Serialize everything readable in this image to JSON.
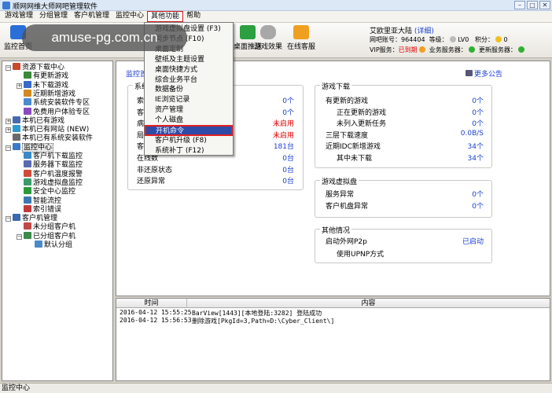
{
  "window": {
    "title": "顺网网维大师网吧管理软件",
    "min": "–",
    "max": "□",
    "close": "✕"
  },
  "menubar": [
    "游戏管理",
    "分组管理",
    "客户机管理",
    "监控中心",
    "其他功能",
    "帮助"
  ],
  "toolbar": {
    "buttons": [
      {
        "label": "监控首页",
        "icon": "monitor-home-icon",
        "color": "#2a6fd8"
      },
      {
        "label": "桌面推送",
        "icon": "desktop-push-icon",
        "color": "#2aa040"
      },
      {
        "label": "游戏效果",
        "icon": "gamepad-icon",
        "color": "#9a9a9a"
      },
      {
        "label": "在线客服",
        "icon": "customer-service-icon",
        "color": "#f0a020"
      }
    ],
    "account": {
      "name": "艾欧里亚大陆",
      "detail_link": "(详细)",
      "netbar_label": "网吧账号：",
      "netbar_id": "964404",
      "level_label": "等级：",
      "level": "LV0",
      "points_label": "积分：",
      "points": "0",
      "vip_label": "VIP服务：",
      "vip_status": "已到期",
      "biz_server_label": "业务服务器：",
      "update_server_label": "更新服务器："
    }
  },
  "watermark": "amuse-pg.com.cn",
  "dropdown": {
    "items": [
      "游戏虚拟盘设置 (F3)",
      "同步节点 (F10)",
      "桌面定制",
      "壁纸及主题设置",
      "桌面快捷方式",
      "综合业务平台",
      "数据备份",
      "IE浏览记录",
      "资产管理",
      "个人磁盘",
      "开机命令",
      "客户机升级 (F8)",
      "系统补丁 (F12)"
    ],
    "highlighted_index": 10
  },
  "tree": [
    {
      "label": "资源下载中心",
      "level": 0,
      "expander": "⊟",
      "color": "#c84a2a"
    },
    {
      "label": "有更新游戏",
      "level": 1,
      "color": "#3a8a3a"
    },
    {
      "label": "未下载游戏",
      "level": 1,
      "expander": "⊞",
      "color": "#3a6ac8"
    },
    {
      "label": "近期新增游戏",
      "level": 1,
      "color": "#d08a20"
    },
    {
      "label": "系统安装软件专区",
      "level": 1,
      "color": "#4a8ad0"
    },
    {
      "label": "免费用户体验专区",
      "level": 1,
      "color": "#8a4ac0"
    },
    {
      "label": "本机已有游戏",
      "level": 0,
      "expander": "⊞",
      "color": "#4a6ab0"
    },
    {
      "label": "本机已有网站 (NEW)",
      "level": 0,
      "expander": "⊞",
      "color": "#2a9ad0"
    },
    {
      "label": "本机已有系统安装软件",
      "level": 0,
      "color": "#6a6a6a"
    },
    {
      "label": "监控中心",
      "level": 0,
      "expander": "⊟",
      "color": "#3a7ac8",
      "selected": true
    },
    {
      "label": "客户机下载监控",
      "level": 1,
      "color": "#3a8ac8"
    },
    {
      "label": "服务器下载监控",
      "level": 1,
      "color": "#5a6ab0"
    },
    {
      "label": "客户机温度报警",
      "level": 1,
      "color": "#d04a3a"
    },
    {
      "label": "游戏虚拟盘监控",
      "level": 1,
      "color": "#3a9a6a"
    },
    {
      "label": "安全中心监控",
      "level": 1,
      "color": "#2a9a3a"
    },
    {
      "label": "智能流控",
      "level": 1,
      "color": "#3a7ab0"
    },
    {
      "label": "索引错误",
      "level": 1,
      "color": "#c03a3a"
    },
    {
      "label": "客户机管理",
      "level": 0,
      "expander": "⊟",
      "color": "#3a6ab0"
    },
    {
      "label": "未分组客户机",
      "level": 1,
      "color": "#c04a4a"
    },
    {
      "label": "已分组客户机",
      "level": 1,
      "expander": "⊟",
      "color": "#3a8a4a"
    },
    {
      "label": "默认分组",
      "level": 2,
      "color": "#4a8ac8"
    }
  ],
  "main": {
    "crumb": "监控首页 >>",
    "more_link": "更多公告",
    "system_group": {
      "title": "系统",
      "rows": [
        {
          "label": "索",
          "value": "0个",
          "color": "#1a3fd0"
        },
        {
          "label": "客",
          "value": "0个",
          "color": "#1a3fd0"
        },
        {
          "label": "病",
          "value": "未启用",
          "color": "#e00000"
        },
        {
          "label": "局",
          "value": "未启用",
          "color": "#e00000"
        },
        {
          "label": "客",
          "value": "181台",
          "color": "#1a3fd0"
        },
        {
          "label": "在线数",
          "value": "0台",
          "color": "#1a3fd0"
        },
        {
          "label": "非还原状态",
          "value": "0台",
          "color": "#1a3fd0"
        },
        {
          "label": "还原异常",
          "value": "0台",
          "color": "#1a3fd0"
        }
      ]
    },
    "game_download": {
      "title": "游戏下载",
      "rows": [
        {
          "label": "有更新的游戏",
          "value": "0个"
        },
        {
          "label": "正在更新的游戏",
          "value": "0个",
          "indent": true
        },
        {
          "label": "未列入更新任务",
          "value": "0个",
          "indent": true
        },
        {
          "label": "三层下载速度",
          "value": "0.0B/S"
        },
        {
          "label": "近期IDC新增游戏",
          "value": "34个"
        },
        {
          "label": "其中未下载",
          "value": "34个",
          "indent": true
        }
      ]
    },
    "game_vdisk": {
      "title": "游戏虚拟盘",
      "rows": [
        {
          "label": "服务异常",
          "value": "0个"
        },
        {
          "label": "客户机盘异常",
          "value": "0个"
        }
      ]
    },
    "other": {
      "title": "其他情况",
      "rows": [
        {
          "label": "启动外网P2p",
          "value": "已启动"
        },
        {
          "label": "使用UPNP方式",
          "value": ""
        }
      ]
    }
  },
  "log": {
    "columns": [
      "时间",
      "内容"
    ],
    "rows": [
      {
        "time": "2016-04-12 15:55:25",
        "content": "BarView[1443][本地登陆:3282] 登陆成功"
      },
      {
        "time": "2016-04-12 15:56:53",
        "content": "删除游戏[PkgId=3,Path=D:\\Cyber_Client\\]"
      }
    ]
  },
  "statusbar": "监控中心",
  "colors": {
    "accent": "#1a3fd0",
    "alert": "#e00000",
    "highlight": "#2f4ba8",
    "ok": "#30b030"
  }
}
